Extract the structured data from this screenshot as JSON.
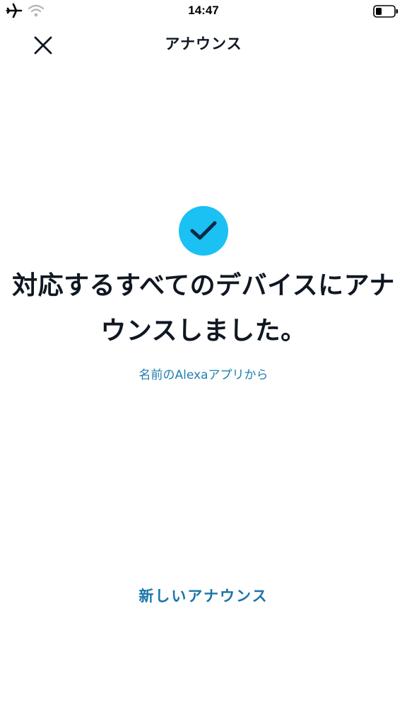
{
  "status_bar": {
    "time": "14:47",
    "icons": [
      "airplane-icon",
      "wifi-icon",
      "battery-icon"
    ]
  },
  "header": {
    "title": "アナウンス",
    "close_icon": "close-icon"
  },
  "main": {
    "status_icon": "check-circle-icon",
    "message": "対応するすべてのデバイスにアナウンスしました。",
    "subtext": "名前のAlexaアプリから",
    "new_announcement_label": "新しいアナウンス"
  },
  "colors": {
    "accent": "#1bc1f2",
    "link": "#1a75a8",
    "text": "#0f1722"
  }
}
